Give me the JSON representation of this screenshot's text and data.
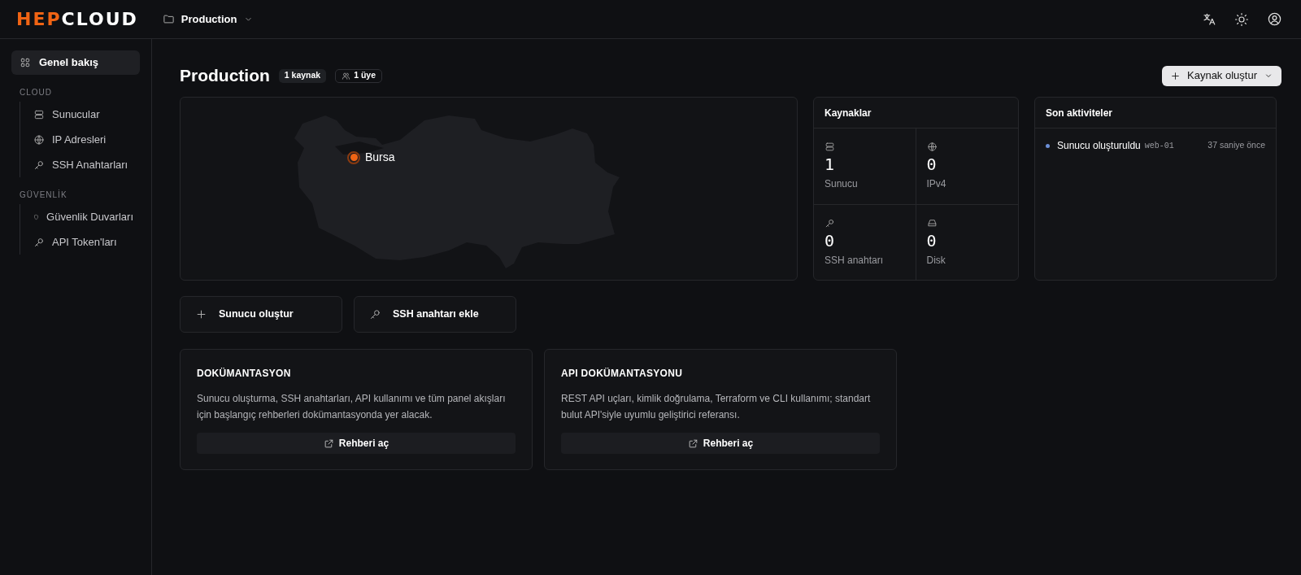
{
  "header": {
    "logo": {
      "primary": "HEP",
      "secondary": "CLOUD"
    },
    "project": "Production"
  },
  "sidebar": {
    "top": [
      {
        "label": "Genel bakış",
        "kind": "grid",
        "selected": true
      }
    ],
    "sections": [
      {
        "title": "CLOUD",
        "items": [
          {
            "label": "Sunucular",
            "kind": "server",
            "selected": false
          },
          {
            "label": "IP Adresleri",
            "kind": "globe",
            "selected": false
          },
          {
            "label": "SSH Anahtarları",
            "kind": "key",
            "selected": false
          }
        ]
      },
      {
        "title": "GÜVENLİK",
        "items": [
          {
            "label": "Güvenlik Duvarları",
            "kind": "shield",
            "selected": false
          },
          {
            "label": "API Token'ları",
            "kind": "key",
            "selected": false
          }
        ]
      }
    ]
  },
  "page": {
    "title": "Production",
    "badges": [
      {
        "label": "1 kaynak",
        "kind": "plain"
      },
      {
        "label": "1 üye",
        "kind": "users"
      }
    ],
    "create_button": "Kaynak oluştur"
  },
  "map": {
    "pin": "Bursa"
  },
  "resources": {
    "title": "Kaynaklar",
    "stats": [
      {
        "kind": "server",
        "value": "1",
        "label": "Sunucu"
      },
      {
        "kind": "globe",
        "value": "0",
        "label": "IPv4"
      },
      {
        "kind": "key",
        "value": "0",
        "label": "SSH anahtarı"
      },
      {
        "kind": "disk",
        "value": "0",
        "label": "Disk"
      }
    ]
  },
  "activity": {
    "title": "Son aktiviteler",
    "items": [
      {
        "text": "Sunucu oluşturuldu",
        "code": "web-01",
        "time": "37 saniye önce",
        "color": "#6b8fd6"
      }
    ]
  },
  "quick_actions": [
    {
      "label": "Sunucu oluştur",
      "kind": "plus"
    },
    {
      "label": "SSH anahtarı ekle",
      "kind": "key"
    }
  ],
  "docs": [
    {
      "title": "DOKÜMANTASYON",
      "text": "Sunucu oluşturma, SSH anahtarları, API kullanımı ve tüm panel akışları için başlangıç rehberleri dokümantasyonda yer alacak.",
      "button": "Rehberi aç"
    },
    {
      "title": "API DOKÜMANTASYONU",
      "text": "REST API uçları, kimlik doğrulama, Terraform ve CLI kullanımı; standart bulut API'siyle uyumlu geliştirici referansı.",
      "button": "Rehberi aç"
    }
  ]
}
